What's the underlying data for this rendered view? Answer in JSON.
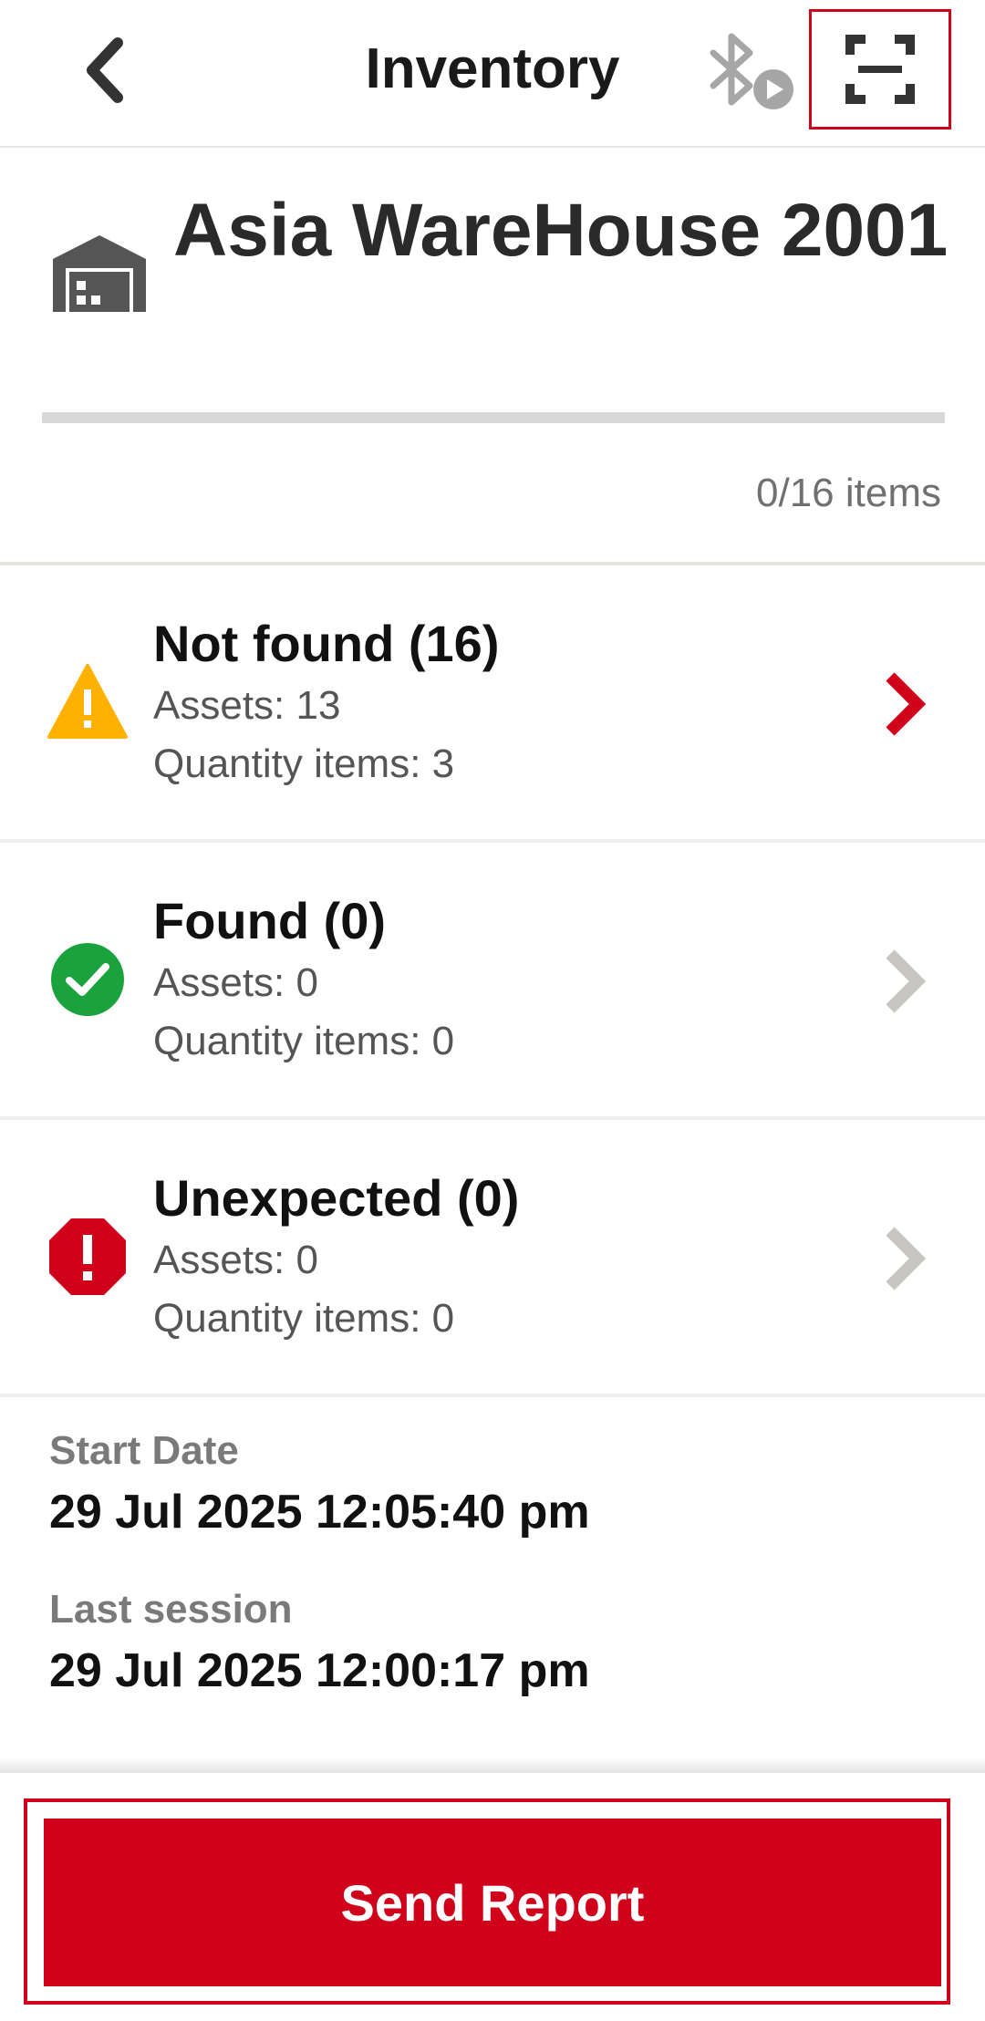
{
  "header": {
    "title": "Inventory",
    "back_icon": "chevron-left-icon",
    "bluetooth_icon": "bluetooth-play-icon",
    "scan_icon": "scan-frame-icon"
  },
  "warehouse": {
    "icon": "warehouse-icon",
    "name": "Asia WareHouse 2001",
    "progress_fraction": 0,
    "count_label": "0/16 items"
  },
  "statuses": [
    {
      "icon": "warning-icon",
      "title": "Not found (16)",
      "assets": "Assets: 13",
      "quantity": "Quantity items: 3",
      "chevron_color": "#d0021b"
    },
    {
      "icon": "check-circle-icon",
      "title": "Found (0)",
      "assets": "Assets: 0",
      "quantity": "Quantity items: 0",
      "chevron_color": "#c8c6c2"
    },
    {
      "icon": "error-octagon-icon",
      "title": "Unexpected (0)",
      "assets": "Assets: 0",
      "quantity": "Quantity items: 0",
      "chevron_color": "#c8c6c2"
    }
  ],
  "dates": {
    "start_label": "Start Date",
    "start_value": "29 Jul 2025 12:05:40 pm",
    "last_label": "Last session",
    "last_value": "29 Jul 2025 12:00:17 pm"
  },
  "footer": {
    "send_label": "Send Report"
  },
  "colors": {
    "accent": "#d0021b",
    "warning": "#ffb100",
    "success": "#1aa33c",
    "error": "#d0021b"
  }
}
